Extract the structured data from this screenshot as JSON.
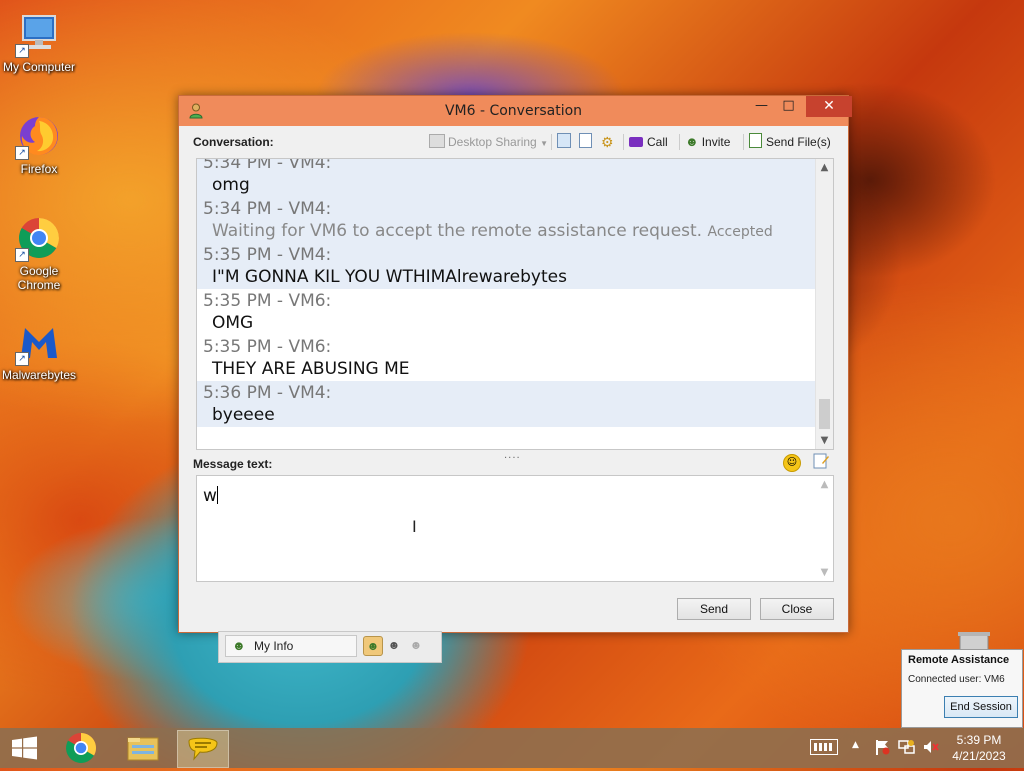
{
  "desktop": {
    "icons": [
      {
        "label": "My Computer"
      },
      {
        "label": "Firefox"
      },
      {
        "label": "Google Chrome"
      },
      {
        "label": "Malwarebytes"
      }
    ],
    "recycle_bin_label": "Recycle Bin"
  },
  "window": {
    "title": "VM6 - Conversation",
    "conversation_label": "Conversation:",
    "toolbar": {
      "desktop_sharing": "Desktop Sharing",
      "call": "Call",
      "invite": "Invite",
      "send_files": "Send File(s)"
    },
    "messages": [
      {
        "header": "5:34 PM - VM4:",
        "text": "omg",
        "alt": true,
        "faded": false
      },
      {
        "header": "5:34 PM - VM4:",
        "text": "Waiting for VM6 to accept the remote assistance request.",
        "status": "Accepted",
        "alt": true,
        "faded": true
      },
      {
        "header": "5:35 PM - VM4:",
        "text": "I\"M GONNA KIL YOU WTHIMAlrewarebytes",
        "alt": true,
        "faded": false
      },
      {
        "header": "5:35 PM - VM6:",
        "text": "OMG",
        "alt": false,
        "faded": false
      },
      {
        "header": "5:35 PM - VM6:",
        "text": "THEY ARE ABUSING ME",
        "alt": false,
        "faded": false
      },
      {
        "header": "5:36 PM - VM4:",
        "text": "byeeee",
        "alt": true,
        "faded": false
      }
    ],
    "message_text_label": "Message text:",
    "input_value": "w",
    "send_label": "Send",
    "close_label": "Close"
  },
  "myinfo": {
    "label": "My Info"
  },
  "remote_assistance": {
    "title": "Remote Assistance",
    "connected": "Connected user: VM6",
    "end_session": "End Session"
  },
  "taskbar": {
    "time": "5:39 PM",
    "date": "4/21/2023"
  },
  "colors": {
    "titlebar": "#f08b5b",
    "close_button": "#c7422e",
    "message_alt_bg": "#e6edf7"
  }
}
